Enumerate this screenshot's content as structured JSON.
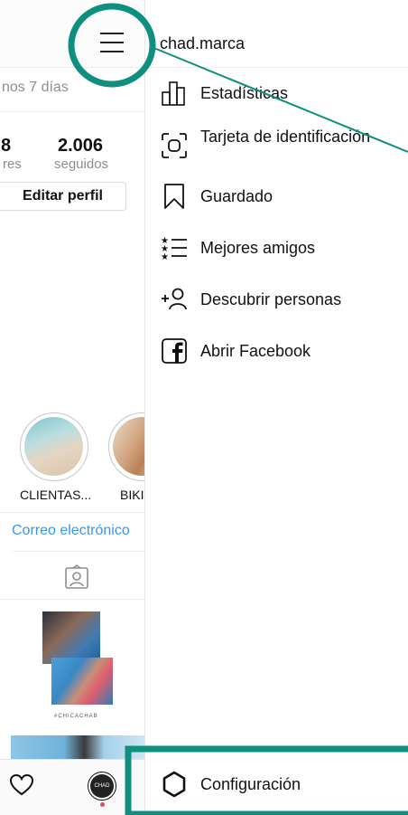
{
  "profile": {
    "partial_period": "nos 7 días",
    "followers_count_partial": "8",
    "followers_label_partial": "res",
    "following_count": "2.006",
    "following_label": "seguidos",
    "edit_profile_label": "Editar perfil",
    "highlights": [
      {
        "label": "CLIENTAS..."
      },
      {
        "label": "BIKI"
      }
    ],
    "email_link": "Correo electrónico",
    "post_caption_tag": "#CHICACHAB"
  },
  "drawer": {
    "username": "chad.marca",
    "menu": [
      {
        "label": "Estadísticas",
        "icon": "insights-bar-chart-icon"
      },
      {
        "label": "Tarjeta de identificación",
        "icon": "nametag-scan-icon"
      },
      {
        "label": "Guardado",
        "icon": "bookmark-icon"
      },
      {
        "label": "Mejores amigos",
        "icon": "close-friends-list-icon"
      },
      {
        "label": "Descubrir personas",
        "icon": "add-person-icon"
      },
      {
        "label": "Abrir Facebook",
        "icon": "facebook-icon"
      }
    ],
    "settings_label": "Configuración"
  },
  "bottom_nav": {
    "avatar_text": "CHAD"
  },
  "colors": {
    "annotation": "#0f8f80",
    "link": "#3897f0",
    "notification_dot": "#ed4956"
  }
}
